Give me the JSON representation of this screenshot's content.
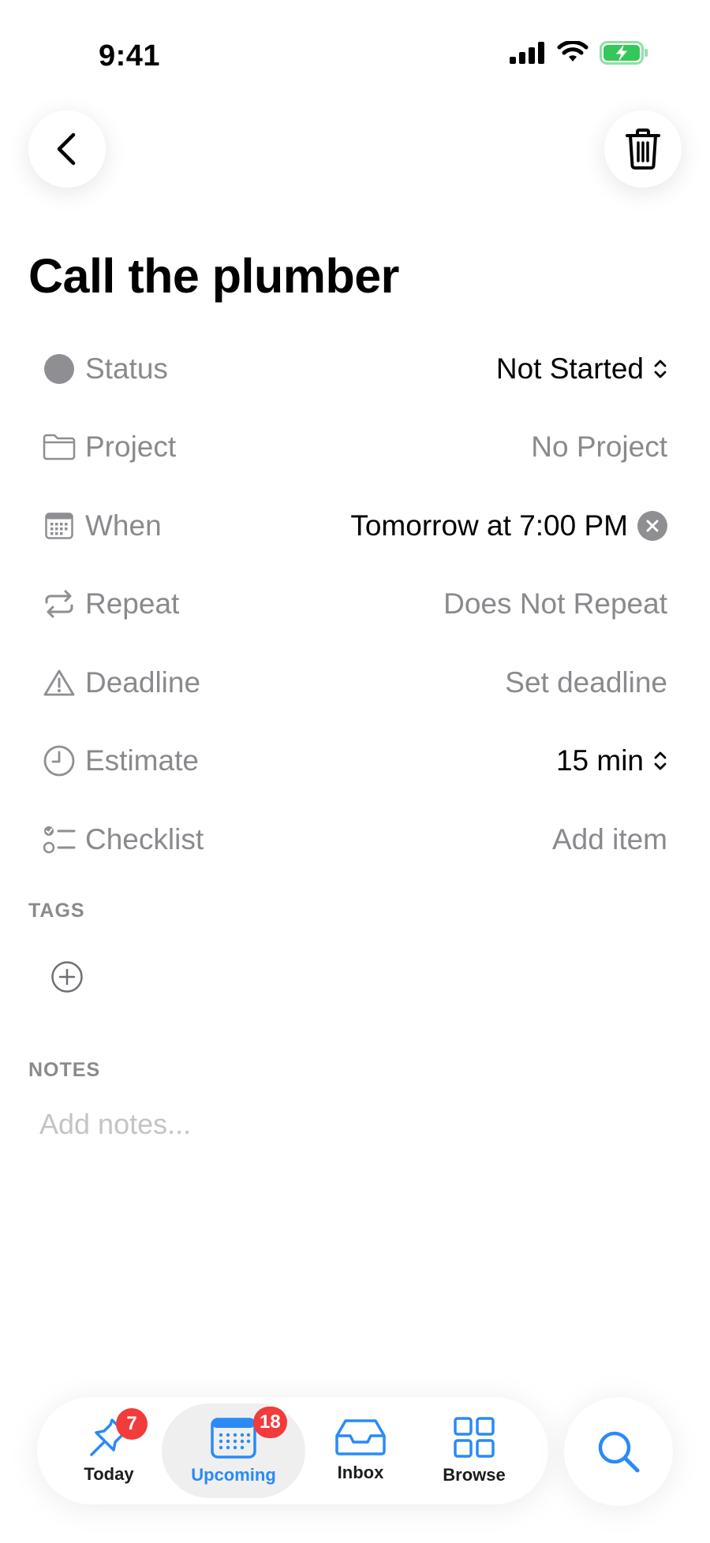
{
  "status_bar": {
    "time": "9:41"
  },
  "task": {
    "title": "Call the plumber"
  },
  "fields": [
    {
      "label": "Status",
      "value": "Not Started"
    },
    {
      "label": "Project",
      "value": "No Project"
    },
    {
      "label": "When",
      "value": "Tomorrow at 7:00 PM"
    },
    {
      "label": "Repeat",
      "value": "Does Not Repeat"
    },
    {
      "label": "Deadline",
      "value": "Set deadline"
    },
    {
      "label": "Estimate",
      "value": "15 min"
    },
    {
      "label": "Checklist",
      "value": "Add item"
    }
  ],
  "tags": {
    "label": "TAGS"
  },
  "notes": {
    "label": "NOTES",
    "placeholder": "Add notes..."
  },
  "tabbar": {
    "tabs": [
      {
        "label": "Today",
        "badge": "7"
      },
      {
        "label": "Upcoming",
        "badge": "18"
      },
      {
        "label": "Inbox"
      },
      {
        "label": "Browse"
      }
    ]
  },
  "colors": {
    "accent": "#2a8af6",
    "badge": "#f23b3b",
    "secondary_text": "#8a8a8e",
    "battery": "#34c759"
  }
}
